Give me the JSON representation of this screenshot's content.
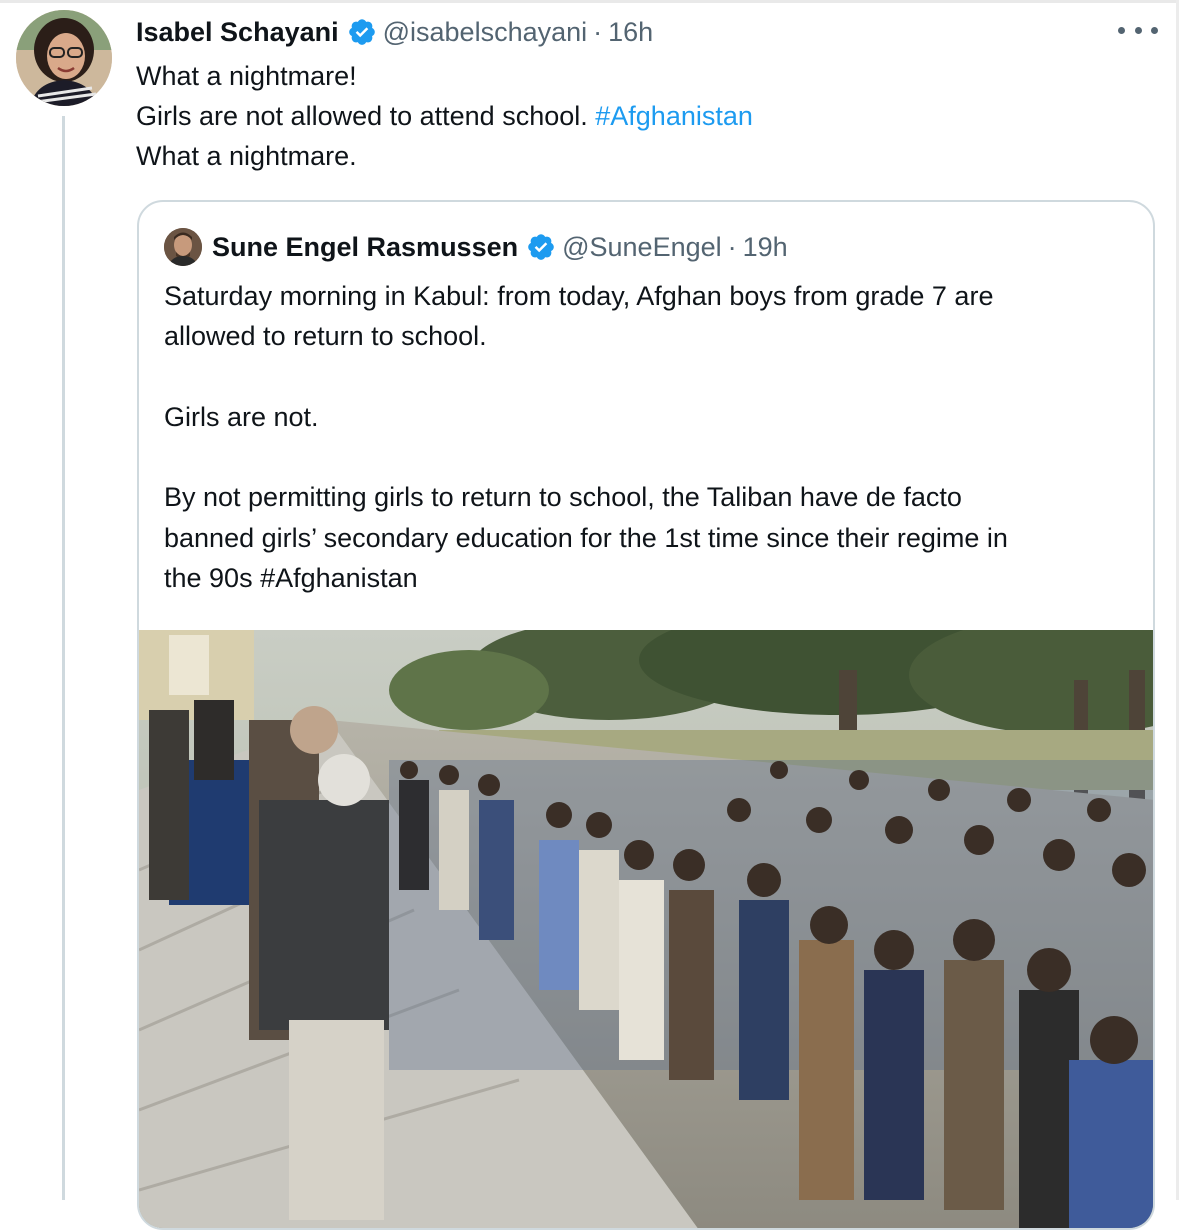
{
  "tweet": {
    "author": {
      "name": "Isabel Schayani",
      "handle": "@isabelschayani",
      "time": "16h",
      "verified": true
    },
    "text_lines": [
      {
        "text": "What a nightmare!"
      },
      {
        "text": "Girls are not allowed to attend school. ",
        "hashtag": "#Afghanistan"
      },
      {
        "text": "What a nightmare."
      }
    ],
    "separator": "·",
    "more_icon": "ellipsis-icon"
  },
  "quoted_tweet": {
    "author": {
      "name": "Sune Engel Rasmussen",
      "handle": "@SuneEngel",
      "time": "19h",
      "verified": true
    },
    "text_lines": [
      "Saturday morning in Kabul: from today, Afghan boys from grade 7 are",
      "allowed to return to school.",
      "",
      "Girls are not.",
      "",
      "By not permitting girls to return to school, the Taliban have de facto",
      "banned girls’ secondary education for the 1st time since their regime in",
      "the 90s #Afghanistan"
    ],
    "media": {
      "type": "photo"
    }
  },
  "colors": {
    "link": "#1d9bf0",
    "secondary_text": "#536471",
    "border": "#cfd9de",
    "verified_badge": "#1d9bf0"
  }
}
